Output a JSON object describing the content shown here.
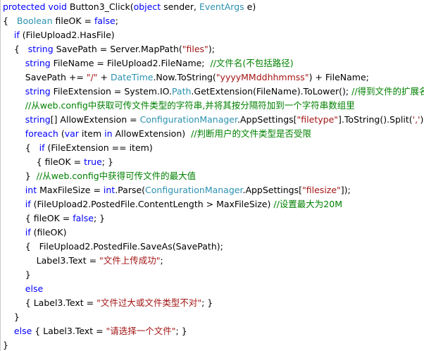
{
  "colors": {
    "keyword": "#0000ff",
    "type": "#2b91af",
    "string": "#a31515",
    "comment": "#008000",
    "plain": "#000000"
  },
  "code": {
    "lines": [
      [
        {
          "t": "kw",
          "s": "protected"
        },
        {
          "t": "pl",
          "s": " "
        },
        {
          "t": "kw",
          "s": "void"
        },
        {
          "t": "pl",
          "s": " Button3_Click("
        },
        {
          "t": "kw",
          "s": "object"
        },
        {
          "t": "pl",
          "s": " sender, "
        },
        {
          "t": "ty",
          "s": "EventArgs"
        },
        {
          "t": "pl",
          "s": " e)"
        }
      ],
      [
        {
          "t": "pl",
          "s": "{   "
        },
        {
          "t": "ty",
          "s": "Boolean"
        },
        {
          "t": "pl",
          "s": " fileOK = "
        },
        {
          "t": "kw",
          "s": "false"
        },
        {
          "t": "pl",
          "s": ";"
        }
      ],
      [
        {
          "t": "pl",
          "s": "    "
        },
        {
          "t": "kw",
          "s": "if"
        },
        {
          "t": "pl",
          "s": " (FileUpload2.HasFile)"
        }
      ],
      [
        {
          "t": "pl",
          "s": "    {   "
        },
        {
          "t": "kw",
          "s": "string"
        },
        {
          "t": "pl",
          "s": " SavePath = Server.MapPath("
        },
        {
          "t": "st",
          "s": "\"files\""
        },
        {
          "t": "pl",
          "s": ");"
        }
      ],
      [
        {
          "t": "pl",
          "s": "        "
        },
        {
          "t": "kw",
          "s": "string"
        },
        {
          "t": "pl",
          "s": " FileName = FileUpload2.FileName;  "
        },
        {
          "t": "cm",
          "s": "//文件名(不包括路径)"
        }
      ],
      [
        {
          "t": "pl",
          "s": "        SavePath += "
        },
        {
          "t": "st",
          "s": "\"/\""
        },
        {
          "t": "pl",
          "s": " + "
        },
        {
          "t": "ty",
          "s": "DateTime"
        },
        {
          "t": "pl",
          "s": ".Now.ToString("
        },
        {
          "t": "st",
          "s": "\"yyyyMMddhhmmss\""
        },
        {
          "t": "pl",
          "s": ") + FileName;"
        }
      ],
      [
        {
          "t": "pl",
          "s": "        "
        },
        {
          "t": "kw",
          "s": "string"
        },
        {
          "t": "pl",
          "s": " FileExtension = System.IO."
        },
        {
          "t": "ty",
          "s": "Path"
        },
        {
          "t": "pl",
          "s": ".GetExtension(FileName).ToLower(); "
        },
        {
          "t": "cm",
          "s": "//得到文件的扩展名"
        }
      ],
      [
        {
          "t": "pl",
          "s": "        "
        },
        {
          "t": "cm",
          "s": "//从web.config中获取可传文件类型的字符串,并将其按分隔符加到一个字符串数组里"
        }
      ],
      [
        {
          "t": "pl",
          "s": "        "
        },
        {
          "t": "kw",
          "s": "string"
        },
        {
          "t": "pl",
          "s": "[] AllowExtension = "
        },
        {
          "t": "ty",
          "s": "ConfigurationManager"
        },
        {
          "t": "pl",
          "s": ".AppSettings["
        },
        {
          "t": "st",
          "s": "\"filetype\""
        },
        {
          "t": "pl",
          "s": "].ToString().Split("
        },
        {
          "t": "st",
          "s": "','"
        },
        {
          "t": "pl",
          "s": ");"
        }
      ],
      [
        {
          "t": "pl",
          "s": "        "
        },
        {
          "t": "kw",
          "s": "foreach"
        },
        {
          "t": "pl",
          "s": " ("
        },
        {
          "t": "kw",
          "s": "var"
        },
        {
          "t": "pl",
          "s": " item "
        },
        {
          "t": "kw",
          "s": "in"
        },
        {
          "t": "pl",
          "s": " AllowExtension)  "
        },
        {
          "t": "cm",
          "s": "//判断用户的文件类型是否受限"
        }
      ],
      [
        {
          "t": "pl",
          "s": "        {   "
        },
        {
          "t": "kw",
          "s": "if"
        },
        {
          "t": "pl",
          "s": " (FileExtension == item)"
        }
      ],
      [
        {
          "t": "pl",
          "s": "            { fileOK = "
        },
        {
          "t": "kw",
          "s": "true"
        },
        {
          "t": "pl",
          "s": "; }"
        }
      ],
      [
        {
          "t": "pl",
          "s": "        }  "
        },
        {
          "t": "cm",
          "s": "//从web.config中获得可传文件的最大值"
        }
      ],
      [
        {
          "t": "pl",
          "s": "        "
        },
        {
          "t": "kw",
          "s": "int"
        },
        {
          "t": "pl",
          "s": " MaxFileSize = "
        },
        {
          "t": "kw",
          "s": "int"
        },
        {
          "t": "pl",
          "s": ".Parse("
        },
        {
          "t": "ty",
          "s": "ConfigurationManager"
        },
        {
          "t": "pl",
          "s": ".AppSettings["
        },
        {
          "t": "st",
          "s": "\"filesize\""
        },
        {
          "t": "pl",
          "s": "]);"
        }
      ],
      [
        {
          "t": "pl",
          "s": "        "
        },
        {
          "t": "kw",
          "s": "if"
        },
        {
          "t": "pl",
          "s": " (FileUpload2.PostedFile.ContentLength > MaxFileSize) "
        },
        {
          "t": "cm",
          "s": "//设置最大为20M"
        }
      ],
      [
        {
          "t": "pl",
          "s": "        { fileOK = "
        },
        {
          "t": "kw",
          "s": "false"
        },
        {
          "t": "pl",
          "s": "; }"
        }
      ],
      [
        {
          "t": "pl",
          "s": "        "
        },
        {
          "t": "kw",
          "s": "if"
        },
        {
          "t": "pl",
          "s": " (fileOK)"
        }
      ],
      [
        {
          "t": "pl",
          "s": "        {   FileUpload2.PostedFile.SaveAs(SavePath);"
        }
      ],
      [
        {
          "t": "pl",
          "s": "            Label3.Text = "
        },
        {
          "t": "st",
          "s": "\"文件上传成功\""
        },
        {
          "t": "pl",
          "s": ";"
        }
      ],
      [
        {
          "t": "pl",
          "s": "        }"
        }
      ],
      [
        {
          "t": "pl",
          "s": "        "
        },
        {
          "t": "kw",
          "s": "else"
        }
      ],
      [
        {
          "t": "pl",
          "s": "        { Label3.Text = "
        },
        {
          "t": "st",
          "s": "\"文件过大或文件类型不对\""
        },
        {
          "t": "pl",
          "s": "; }"
        }
      ],
      [
        {
          "t": "pl",
          "s": "    }"
        }
      ],
      [
        {
          "t": "pl",
          "s": "    "
        },
        {
          "t": "kw",
          "s": "else"
        },
        {
          "t": "pl",
          "s": " { Label3.Text = "
        },
        {
          "t": "st",
          "s": "\"请选择一个文件\""
        },
        {
          "t": "pl",
          "s": "; }"
        }
      ],
      [
        {
          "t": "pl",
          "s": "}"
        }
      ]
    ]
  }
}
